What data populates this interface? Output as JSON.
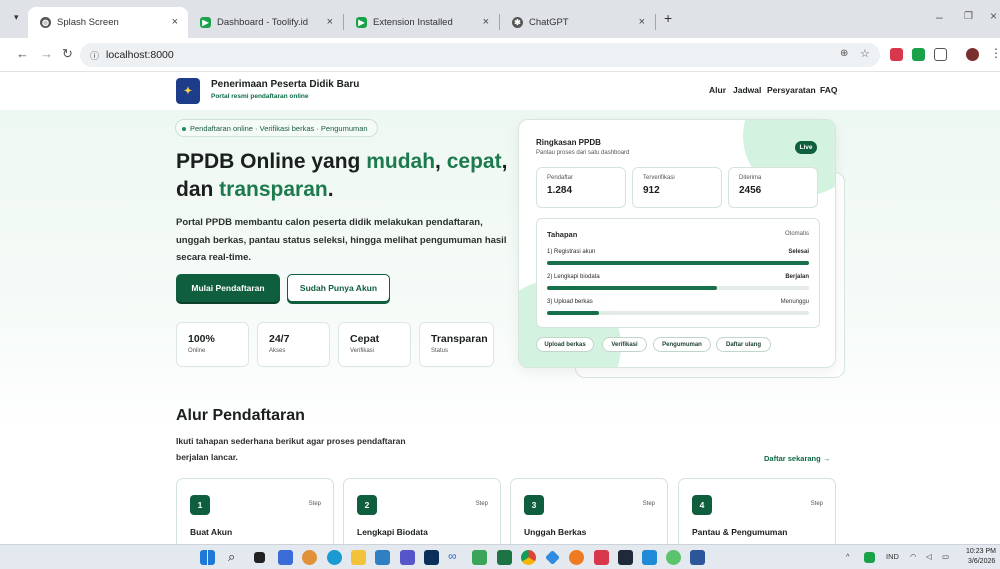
{
  "browser": {
    "tabs": [
      {
        "title": "Splash Screen",
        "favicon": "globe-icon",
        "active": true
      },
      {
        "title": "Dashboard - Toolify.id",
        "favicon": "toolify-icon"
      },
      {
        "title": "Extension Installed",
        "favicon": "toolify-icon"
      },
      {
        "title": "ChatGPT",
        "favicon": "chatgpt-icon"
      }
    ],
    "new_tab": "+",
    "close": "×",
    "url": "localhost:8000"
  },
  "header": {
    "brand_title": "Penerimaan Peserta Didik Baru",
    "brand_subtitle": "Portal resmi pendaftaran online",
    "nav": [
      "Alur",
      "Jadwal",
      "Persyaratan",
      "FAQ"
    ]
  },
  "hero": {
    "pill": "Pendaftaran online · Verifikasi berkas · Pengumuman",
    "title_line1_a": "PPDB Online yang ",
    "title_line1_b": "mudah",
    "title_line1_c": ", ",
    "title_line1_d": "cepat",
    "title_line1_e": ",",
    "title_line2_a": "dan ",
    "title_line2_b": "transparan",
    "title_line2_c": ".",
    "lead": "Portal PPDB membantu calon peserta didik melakukan pendaftaran, unggah berkas, pantau status seleksi, hingga melihat pengumuman hasil secara real-time.",
    "primary_button": "Mulai Pendaftaran",
    "secondary_button": "Sudah Punya Akun",
    "stats": [
      {
        "value": "100%",
        "label": "Online"
      },
      {
        "value": "24/7",
        "label": "Akses"
      },
      {
        "value": "Cepat",
        "label": "Verifikasi"
      },
      {
        "value": "Transparan",
        "label": "Status"
      }
    ]
  },
  "summary": {
    "title": "Ringkasan PPDB",
    "subtitle": "Pantau proses dari satu dashboard",
    "badge": "Live",
    "metrics": [
      {
        "label": "Pendaftar",
        "value": "1.284"
      },
      {
        "label": "Terverifikasi",
        "value": "912"
      },
      {
        "label": "Diterima",
        "value": "2456"
      }
    ],
    "steps_title": "Tahapan",
    "steps_mode": "Otomatis",
    "steps": [
      {
        "label": "1) Registrasi akun",
        "status": "Selesai",
        "progress": 1.0
      },
      {
        "label": "2) Lengkapi biodata",
        "status": "Berjalan",
        "progress": 0.65
      },
      {
        "label": "3) Upload berkas",
        "status": "Menunggu",
        "progress": 0.2
      }
    ],
    "chips": [
      "Upload berkas",
      "Verifikasi",
      "Pengumuman",
      "Daftar ulang"
    ]
  },
  "flow": {
    "title": "Alur Pendaftaran",
    "subtitle": "Ikuti tahapan sederhana berikut agar proses pendaftaran berjalan lancar.",
    "link": "Daftar sekarang →",
    "cards": [
      {
        "num": "1",
        "tag": "Step",
        "title": "Buat Akun"
      },
      {
        "num": "2",
        "tag": "Step",
        "title": "Lengkapi Biodata"
      },
      {
        "num": "3",
        "tag": "Step",
        "title": "Unggah Berkas"
      },
      {
        "num": "4",
        "tag": "Step",
        "title": "Pantau & Pengumuman"
      }
    ]
  },
  "taskbar": {
    "lang": "IND",
    "time": "10:23 PM",
    "date": "3/6/2026"
  },
  "colors": {
    "primary": "#0f5e3d",
    "accent": "#1d7a4e",
    "hero_bg": "#eef8f2"
  }
}
